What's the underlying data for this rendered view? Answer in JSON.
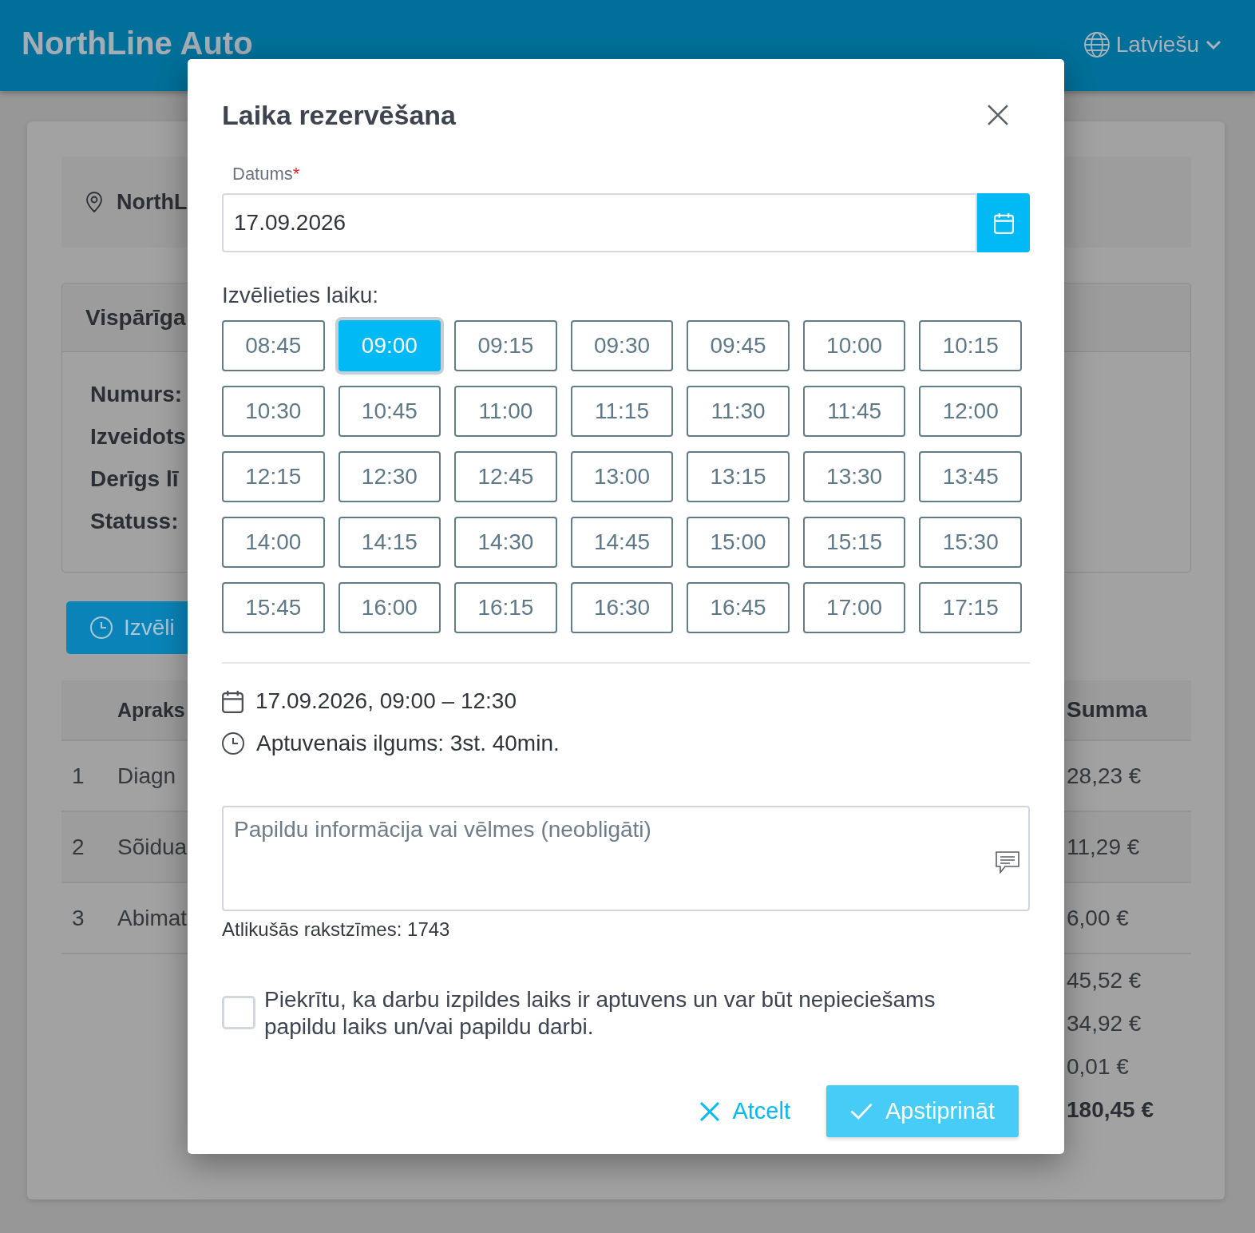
{
  "header": {
    "logo": "NorthLine Auto",
    "language": "Latviešu"
  },
  "background": {
    "location": "NorthL",
    "info_panel": {
      "title": "Vispārīga",
      "labels": [
        "Numurs:",
        "Izveidots",
        "Derīgs lī",
        "Statuss:"
      ]
    },
    "schedule_button": "Izvēli",
    "table": {
      "columns": [
        "Apraks",
        "Summa"
      ],
      "rows": [
        {
          "number": "1",
          "description": "Diagn",
          "amount": "28,23 €"
        },
        {
          "number": "2",
          "description": "Sõidua",
          "amount": "11,29 €"
        },
        {
          "number": "3",
          "description": "Abimat",
          "amount": "6,00 €"
        }
      ]
    },
    "totals": [
      {
        "kind": "subtotal",
        "amount": "45,52 €"
      },
      {
        "kind": "subtotal",
        "amount": "34,92 €"
      },
      {
        "kind": "subtotal",
        "amount": "0,01 €"
      },
      {
        "kind": "grand_total",
        "amount": "180,45 €"
      }
    ]
  },
  "dialog": {
    "title": "Laika rezervēšana",
    "date_field": {
      "label": "Datums",
      "required_mark": "*",
      "value": "17.09.2026"
    },
    "slots_label": "Izvēlieties laiku:",
    "time_slots": [
      {
        "time": "08:45",
        "selected": false
      },
      {
        "time": "09:00",
        "selected": true
      },
      {
        "time": "09:15",
        "selected": false
      },
      {
        "time": "09:30",
        "selected": false
      },
      {
        "time": "09:45",
        "selected": false
      },
      {
        "time": "10:00",
        "selected": false
      },
      {
        "time": "10:15",
        "selected": false
      },
      {
        "time": "10:30",
        "selected": false
      },
      {
        "time": "10:45",
        "selected": false
      },
      {
        "time": "11:00",
        "selected": false
      },
      {
        "time": "11:15",
        "selected": false
      },
      {
        "time": "11:30",
        "selected": false
      },
      {
        "time": "11:45",
        "selected": false
      },
      {
        "time": "12:00",
        "selected": false
      },
      {
        "time": "12:15",
        "selected": false
      },
      {
        "time": "12:30",
        "selected": false
      },
      {
        "time": "12:45",
        "selected": false
      },
      {
        "time": "13:00",
        "selected": false
      },
      {
        "time": "13:15",
        "selected": false
      },
      {
        "time": "13:30",
        "selected": false
      },
      {
        "time": "13:45",
        "selected": false
      },
      {
        "time": "14:00",
        "selected": false
      },
      {
        "time": "14:15",
        "selected": false
      },
      {
        "time": "14:30",
        "selected": false
      },
      {
        "time": "14:45",
        "selected": false
      },
      {
        "time": "15:00",
        "selected": false
      },
      {
        "time": "15:15",
        "selected": false
      },
      {
        "time": "15:30",
        "selected": false
      },
      {
        "time": "15:45",
        "selected": false
      },
      {
        "time": "16:00",
        "selected": false
      },
      {
        "time": "16:15",
        "selected": false
      },
      {
        "time": "16:30",
        "selected": false
      },
      {
        "time": "16:45",
        "selected": false
      },
      {
        "time": "17:00",
        "selected": false
      },
      {
        "time": "17:15",
        "selected": false
      }
    ],
    "summary": [
      {
        "kind": "date",
        "text": "17.09.2026, 09:00 – 12:30"
      },
      {
        "kind": "duration",
        "text": "Aptuvenais ilgums: 3st. 40min."
      }
    ],
    "notes_field": {
      "placeholder": "Papildu informācija vai vēlmes (neobligāti)"
    },
    "char_counter": "Atlikušās rakstzīmes: 1743",
    "agreement": {
      "checked": false,
      "text": "Piekrītu, ka darbu izpildes laiks ir aptuvens un var būt nepieciešams papildu laiks un/vai papildu darbi."
    },
    "buttons": [
      {
        "kind": "cancel",
        "label": "Atcelt",
        "disabled": false
      },
      {
        "kind": "confirm",
        "label": "Apstiprināt",
        "disabled": true
      }
    ]
  }
}
